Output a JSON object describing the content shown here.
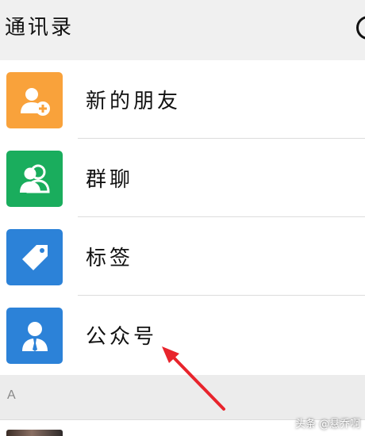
{
  "header": {
    "title": "通讯录"
  },
  "menu": {
    "new_friends": {
      "label": "新的朋友",
      "icon": "add-user-icon",
      "color": "#f9a23b"
    },
    "group_chat": {
      "label": "群聊",
      "icon": "group-icon",
      "color": "#1aad5d"
    },
    "tags": {
      "label": "标签",
      "icon": "tag-icon",
      "color": "#2c82d8"
    },
    "official_accounts": {
      "label": "公众号",
      "icon": "person-icon",
      "color": "#2c82d8"
    }
  },
  "section": {
    "letter": "A"
  },
  "watermark": "头条 @悬乔啊",
  "annotation": {
    "color": "#e8242c"
  }
}
